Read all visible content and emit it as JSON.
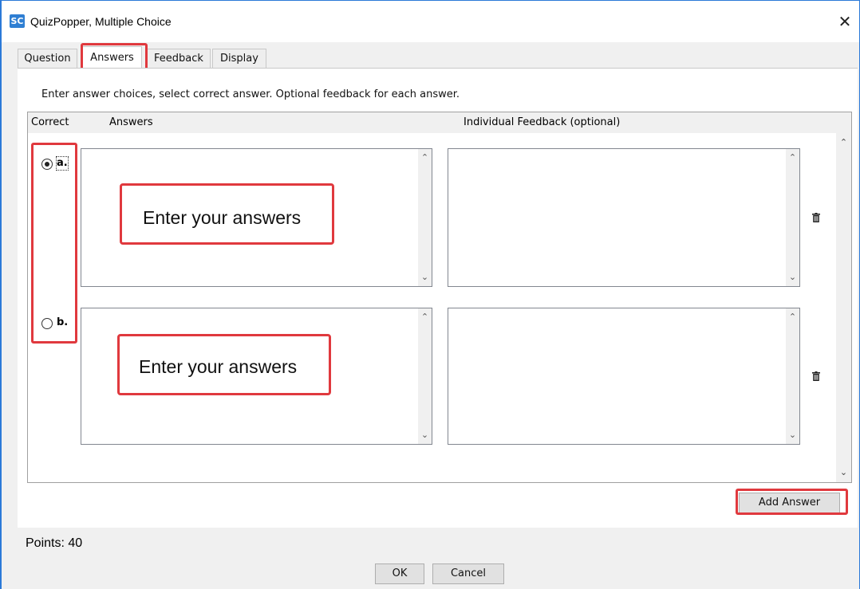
{
  "window": {
    "app_icon": "SC",
    "title": "QuizPopper, Multiple Choice",
    "close_symbol": "✕"
  },
  "tabs": [
    {
      "label": "Question",
      "active": false
    },
    {
      "label": "Answers",
      "active": true
    },
    {
      "label": "Feedback",
      "active": false
    },
    {
      "label": "Display",
      "active": false
    }
  ],
  "answers_tab": {
    "instructions": "Enter answer choices, select correct answer. Optional feedback for each answer.",
    "columns": {
      "correct": "Correct",
      "answers": "Answers",
      "feedback": "Individual Feedback (optional)"
    },
    "rows": [
      {
        "letter": "a.",
        "correct": true,
        "answer_value": "",
        "feedback_value": "",
        "callout": "Enter your answers"
      },
      {
        "letter": "b.",
        "correct": false,
        "answer_value": "",
        "feedback_value": "",
        "callout": "Enter your answers"
      }
    ],
    "add_answer_label": "Add Answer"
  },
  "footer": {
    "points": "Points: 40",
    "ok_label": "OK",
    "cancel_label": "Cancel"
  },
  "icons": {
    "trash": "trash-icon",
    "scroll_up": "chevron-up-icon",
    "scroll_down": "chevron-down-icon"
  },
  "colors": {
    "highlight": "#e0393e",
    "window_border": "#2b79d8",
    "app_icon": "#2f7fd3"
  }
}
